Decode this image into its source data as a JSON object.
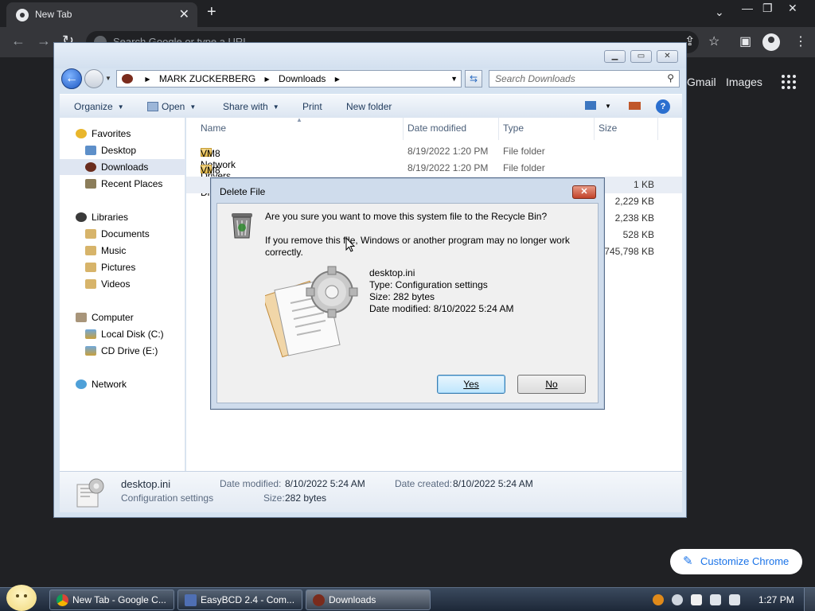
{
  "chrome": {
    "tab_title": "New Tab",
    "omnibox_placeholder": "Search Google or type a URL",
    "ntp_links": [
      "Gmail",
      "Images"
    ],
    "customize_label": "Customize Chrome"
  },
  "explorer": {
    "breadcrumb": [
      "MARK ZUCKERBERG",
      "Downloads"
    ],
    "search_placeholder": "Search Downloads",
    "toolbar": {
      "organize": "Organize",
      "open": "Open",
      "share_with": "Share with",
      "print": "Print",
      "new_folder": "New folder"
    },
    "nav": {
      "favorites": "Favorites",
      "desktop": "Desktop",
      "downloads": "Downloads",
      "recent_places": "Recent Places",
      "libraries": "Libraries",
      "documents": "Documents",
      "music": "Music",
      "pictures": "Pictures",
      "videos": "Videos",
      "computer": "Computer",
      "local_disk": "Local Disk (C:)",
      "cd_drive": "CD Drive (E:)",
      "network": "Network"
    },
    "columns": {
      "name": "Name",
      "date_modified": "Date modified",
      "type": "Type",
      "size": "Size"
    },
    "files": [
      {
        "name": "VM8 Network Drivers",
        "date": "8/19/2022 1:20 PM",
        "type": "File folder",
        "size": ""
      },
      {
        "name": "VM8 VGA Drivers",
        "date": "8/19/2022 1:20 PM",
        "type": "File folder",
        "size": ""
      },
      {
        "name": "",
        "date": "",
        "type": "",
        "size": "1 KB"
      },
      {
        "name": "",
        "date": "",
        "type": "",
        "size": "2,229 KB"
      },
      {
        "name": "",
        "date": "",
        "type": "",
        "size": "2,238 KB"
      },
      {
        "name": "",
        "date": "",
        "type": "",
        "size": "528 KB"
      },
      {
        "name": "",
        "date": "",
        "type": "",
        "size": "745,798 KB"
      }
    ],
    "details": {
      "filename": "desktop.ini",
      "filetype": "Configuration settings",
      "date_modified_label": "Date modified:",
      "date_modified": "8/10/2022 5:24 AM",
      "date_created_label": "Date created:",
      "date_created": "8/10/2022 5:24 AM",
      "size_label": "Size:",
      "size": "282 bytes"
    }
  },
  "dialog": {
    "title": "Delete File",
    "question": "Are you sure you want to move this system file to the Recycle Bin?",
    "warning": "If you remove this file, Windows or another program may no longer work correctly.",
    "file_name": "desktop.ini",
    "file_type": "Type: Configuration settings",
    "file_size": "Size: 282 bytes",
    "file_date": "Date modified: 8/10/2022 5:24 AM",
    "yes_label": "Yes",
    "no_label": "No"
  },
  "taskbar": {
    "buttons": [
      "New Tab - Google C...",
      "EasyBCD 2.4 - Com...",
      "Downloads"
    ],
    "clock": "1:27 PM"
  }
}
